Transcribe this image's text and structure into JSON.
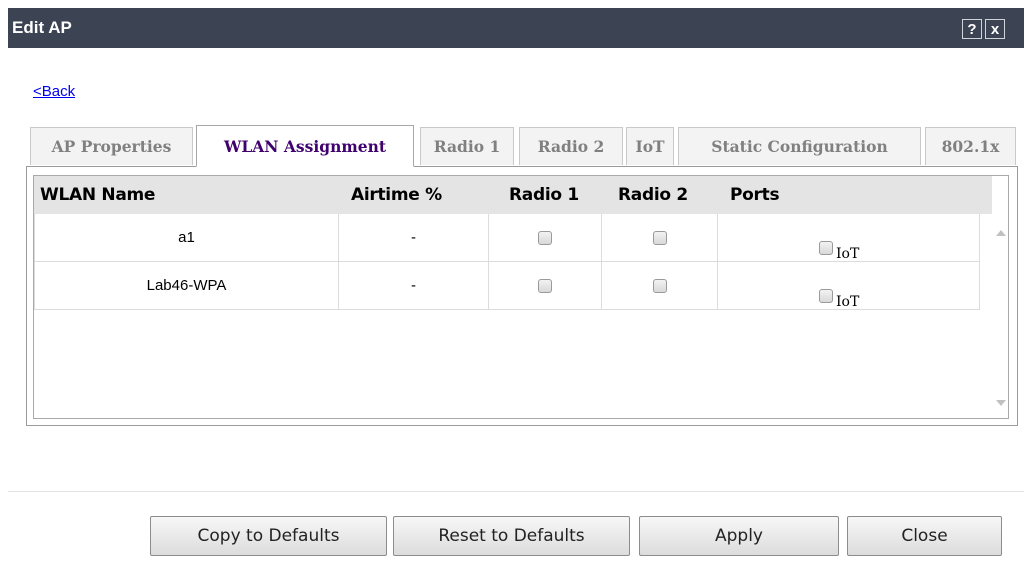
{
  "window": {
    "title": "Edit AP",
    "help_label": "?",
    "close_label": "x"
  },
  "nav": {
    "back_label": "<Back"
  },
  "tabs": [
    {
      "label": "AP Properties",
      "active": false
    },
    {
      "label": "WLAN Assignment",
      "active": true
    },
    {
      "label": "Radio 1",
      "active": false
    },
    {
      "label": "Radio 2",
      "active": false
    },
    {
      "label": "IoT",
      "active": false
    },
    {
      "label": "Static Configuration",
      "active": false
    },
    {
      "label": "802.1x",
      "active": false
    }
  ],
  "grid": {
    "columns": [
      "WLAN Name",
      "Airtime %",
      "Radio 1",
      "Radio 2",
      "Ports"
    ],
    "rows": [
      {
        "wlan_name": "a1",
        "airtime": "-",
        "radio1": false,
        "radio2": false,
        "port_iot": false,
        "port_label": "IoT"
      },
      {
        "wlan_name": "Lab46-WPA",
        "airtime": "-",
        "radio1": false,
        "radio2": false,
        "port_iot": false,
        "port_label": "IoT"
      }
    ]
  },
  "footer": {
    "copy_label": "Copy to Defaults",
    "reset_label": "Reset to Defaults",
    "apply_label": "Apply",
    "close_label": "Close"
  },
  "colors": {
    "titlebar": "#3c4352",
    "active_tab_text": "#40006e",
    "inactive_tab_text": "#808080",
    "link": "#0000ee"
  }
}
